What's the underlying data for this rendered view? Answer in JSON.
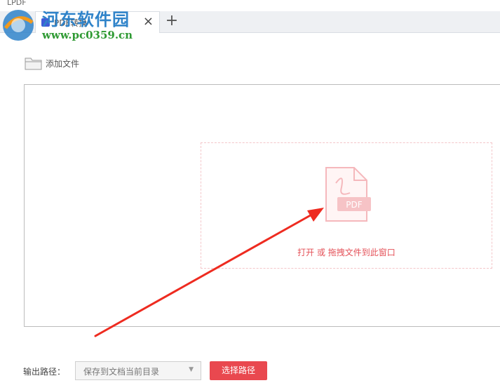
{
  "app": {
    "title": "LPDF"
  },
  "tabs": [
    {
      "label": "PDF转换",
      "active": true
    }
  ],
  "tab_add_glyph": "+",
  "tab_close_glyph": "×",
  "toolbar": {
    "add_file_label": "添加文件",
    "add_file_icon": "folder-icon"
  },
  "dropzone": {
    "icon": "pdf-file-icon",
    "icon_badge": "PDF",
    "hint": "打开 或 拖拽文件到此窗口"
  },
  "output": {
    "label": "输出路径：",
    "selected": "保存到文档当前目录",
    "caret": "▼",
    "choose_label": "选择路径"
  },
  "watermark": {
    "title": "河东软件园",
    "url": "www.pc0359.cn"
  },
  "colors": {
    "accent": "#e9484f",
    "hint_text": "#e45158",
    "dropzone_border": "#f4c6c9",
    "watermark_title": "#2f83c9",
    "watermark_url": "#2f9a33"
  }
}
